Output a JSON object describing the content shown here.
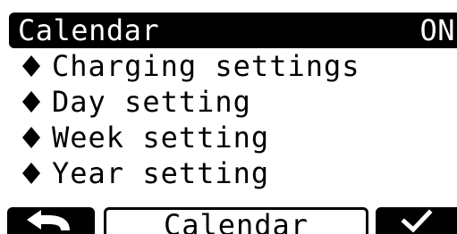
{
  "header": {
    "title": "Calendar",
    "status": "ON"
  },
  "menu": {
    "items": [
      {
        "label": "Charging settings",
        "icon": "diamond-bullet-icon"
      },
      {
        "label": "Day setting",
        "icon": "diamond-bullet-icon"
      },
      {
        "label": "Week setting",
        "icon": "diamond-bullet-icon"
      },
      {
        "label": "Year setting",
        "icon": "diamond-bullet-icon"
      }
    ]
  },
  "softkeys": {
    "left_icon": "back-arrow-icon",
    "middle_label": "Calendar",
    "right_icon": "checkmark-icon"
  }
}
